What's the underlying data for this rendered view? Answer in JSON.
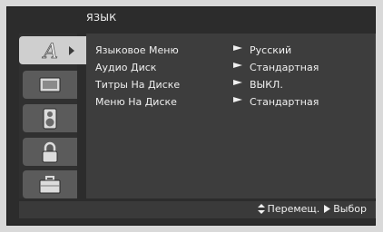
{
  "menu": {
    "title": "ЯЗЫК",
    "tabs": [
      {
        "icon": "language-a-icon",
        "active": true
      },
      {
        "icon": "display-screen-icon",
        "active": false
      },
      {
        "icon": "audio-speaker-icon",
        "active": false
      },
      {
        "icon": "padlock-icon",
        "active": false
      },
      {
        "icon": "briefcase-icon",
        "active": false
      }
    ],
    "rows": [
      {
        "label": "Языковое Меню",
        "value": "Русский"
      },
      {
        "label": "Аудио Диск",
        "value": "Стандартная"
      },
      {
        "label": "Титры На Диске",
        "value": "ВЫКЛ."
      },
      {
        "label": "Меню На Диске",
        "value": "Стандартная"
      }
    ]
  },
  "footer": {
    "move_label": "Перемещ.",
    "select_label": "Выбор"
  },
  "colors": {
    "background": "#2c2c2c",
    "panel": "#3d3d3d",
    "active_tab": "#cfcfcf",
    "text": "#f0f0f0"
  }
}
